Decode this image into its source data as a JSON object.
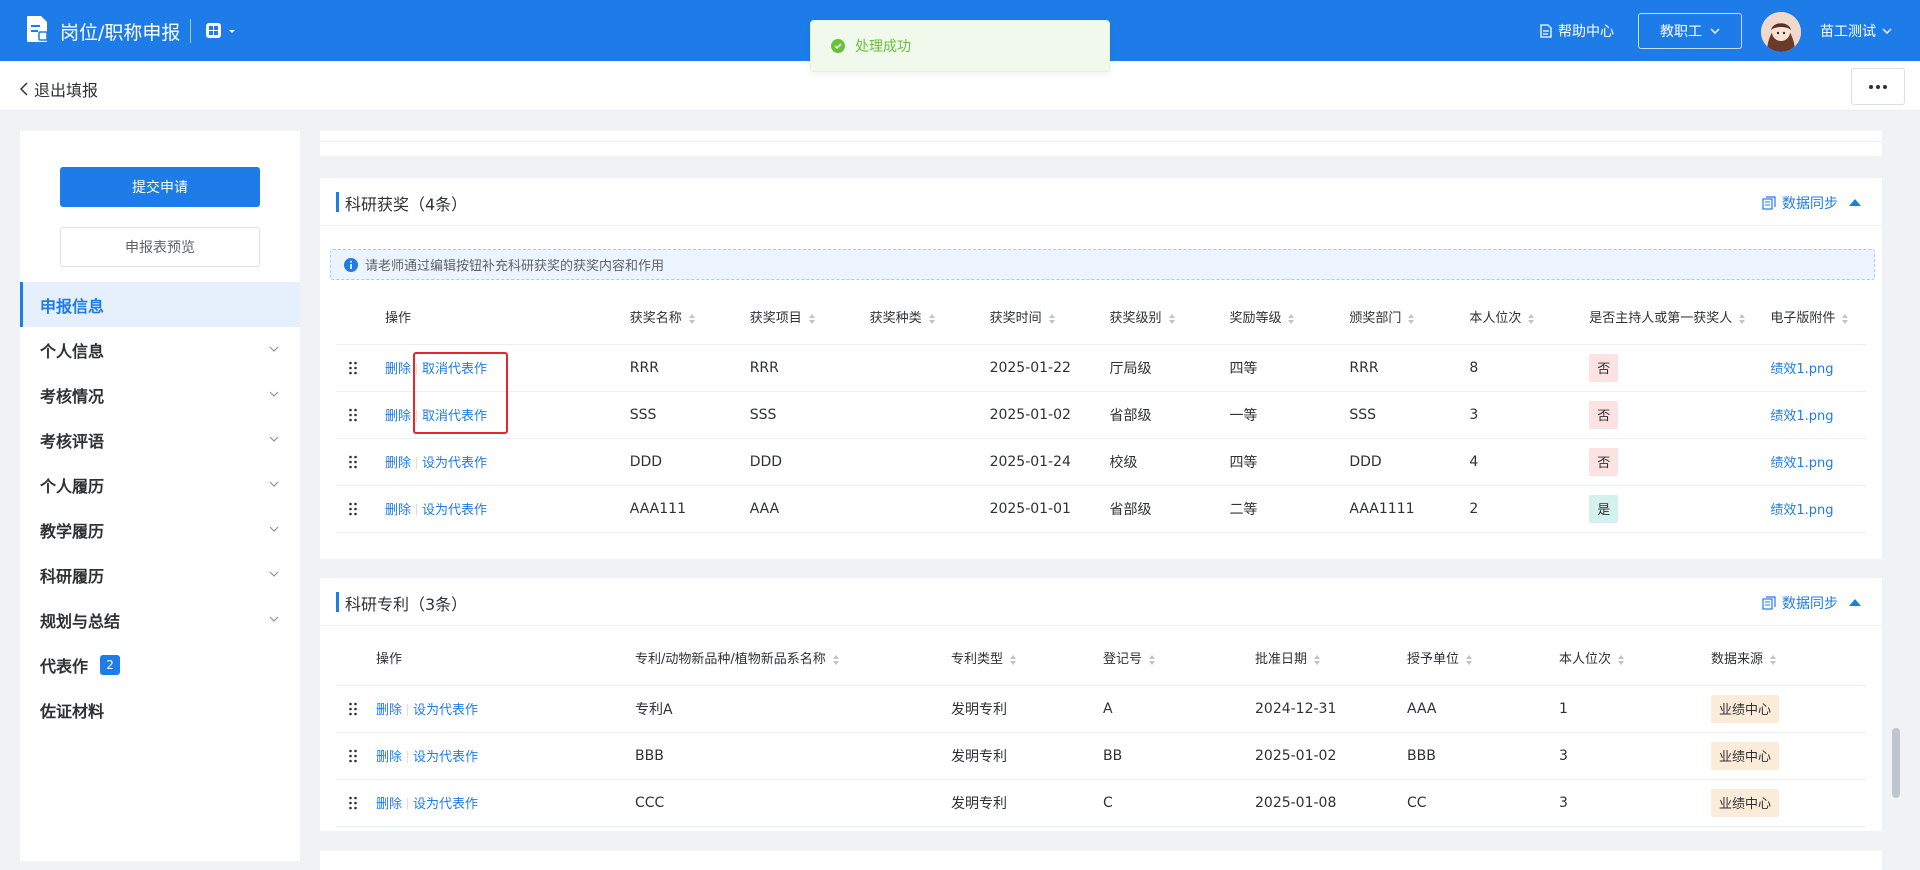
{
  "app": {
    "title": "岗位/职称申报",
    "help_label": "帮助中心",
    "role_label": "教职工",
    "user_name": "苗工测试"
  },
  "toast": {
    "text": "处理成功",
    "color": "#67c23a"
  },
  "subheader": {
    "back_label": "退出填报"
  },
  "sidebar": {
    "submit_label": "提交申请",
    "preview_label": "申报表预览",
    "items": [
      {
        "label": "申报信息",
        "active": true
      },
      {
        "label": "个人信息"
      },
      {
        "label": "考核情况"
      },
      {
        "label": "考核评语"
      },
      {
        "label": "个人履历"
      },
      {
        "label": "教学履历"
      },
      {
        "label": "科研履历"
      },
      {
        "label": "规划与总结"
      },
      {
        "label": "代表作",
        "badge": "2"
      },
      {
        "label": "佐证材料"
      }
    ]
  },
  "awards": {
    "title": "科研获奖（4条）",
    "sync_label": "数据同步",
    "notice": "请老师通过编辑按钮补充科研获奖的获奖内容和作用",
    "columns": [
      "操作",
      "获奖名称",
      "获奖项目",
      "获奖种类",
      "获奖时间",
      "获奖级别",
      "奖励等级",
      "颁奖部门",
      "本人位次",
      "是否主持人或第一获奖人",
      "电子版附件"
    ],
    "rows": [
      {
        "delete": "删除",
        "action": "取消代表作",
        "name": "RRR",
        "project": "RRR",
        "kind": "",
        "date": "2025-01-22",
        "level": "厅局级",
        "grade": "四等",
        "dept": "RRR",
        "rank": "8",
        "first": "否",
        "file": "绩效1.png"
      },
      {
        "delete": "删除",
        "action": "取消代表作",
        "name": "SSS",
        "project": "SSS",
        "kind": "",
        "date": "2025-01-02",
        "level": "省部级",
        "grade": "一等",
        "dept": "SSS",
        "rank": "3",
        "first": "否",
        "file": "绩效1.png"
      },
      {
        "delete": "删除",
        "action": "设为代表作",
        "name": "DDD",
        "project": "DDD",
        "kind": "",
        "date": "2025-01-24",
        "level": "校级",
        "grade": "四等",
        "dept": "DDD",
        "rank": "4",
        "first": "否",
        "file": "绩效1.png"
      },
      {
        "delete": "删除",
        "action": "设为代表作",
        "name": "AAA111",
        "project": "AAA",
        "kind": "",
        "date": "2025-01-01",
        "level": "省部级",
        "grade": "二等",
        "dept": "AAA1111",
        "rank": "2",
        "first": "是",
        "file": "绩效1.png"
      }
    ]
  },
  "patents": {
    "title": "科研专利（3条）",
    "sync_label": "数据同步",
    "columns": [
      "操作",
      "专利/动物新品种/植物新品系名称",
      "专利类型",
      "登记号",
      "批准日期",
      "授予单位",
      "本人位次",
      "数据来源"
    ],
    "rows": [
      {
        "delete": "删除",
        "action": "设为代表作",
        "name": "专利A",
        "type": "发明专利",
        "reg": "A",
        "date": "2024-12-31",
        "unit": "AAA",
        "rank": "1",
        "source": "业绩中心"
      },
      {
        "delete": "删除",
        "action": "设为代表作",
        "name": "BBB",
        "type": "发明专利",
        "reg": "BB",
        "date": "2025-01-02",
        "unit": "BBB",
        "rank": "3",
        "source": "业绩中心"
      },
      {
        "delete": "删除",
        "action": "设为代表作",
        "name": "CCC",
        "type": "发明专利",
        "reg": "C",
        "date": "2025-01-08",
        "unit": "CC",
        "rank": "3",
        "source": "业绩中心"
      }
    ]
  },
  "colors": {
    "primary": "#1e7ce8",
    "highlight": "#e5262a"
  }
}
